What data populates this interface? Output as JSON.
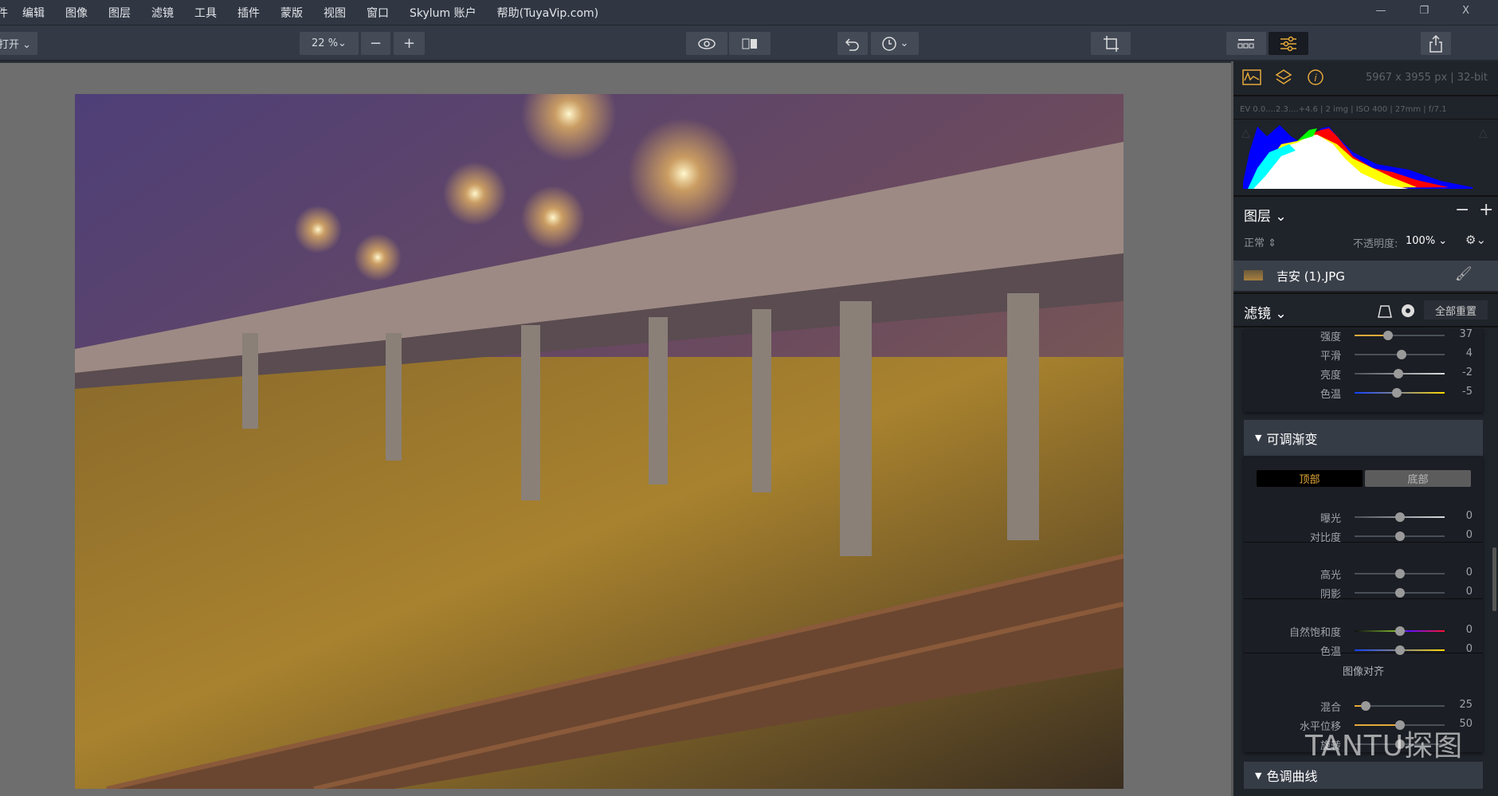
{
  "menu": [
    "编辑",
    "图像",
    "图层",
    "滤镜",
    "工具",
    "插件",
    "蒙版",
    "视图",
    "窗口",
    "Skylum 账户",
    "帮助(TuyaVip.com)"
  ],
  "menu_partial": "件",
  "window_controls": [
    "—",
    "❐",
    "X"
  ],
  "toolbar": {
    "open": "打开 ⌄",
    "zoom": "22 %⌄",
    "zoom_out": "−",
    "zoom_in": "+",
    "history_arrow": "⌄"
  },
  "info": {
    "dimensions": "5967 x 3955 px  |  32-bit",
    "exif": "EV 0.0....2.3....+4.6  |  2 img  |  ISO 400  |  27mm  |  f/7.1"
  },
  "layers": {
    "title": "图层",
    "minus": "−",
    "plus": "+",
    "blend": "正常",
    "opacity_label": "不透明度:",
    "opacity": "100%",
    "layer_name": "吉安 (1).JPG"
  },
  "filters": {
    "title": "滤镜",
    "reset_all": "全部重置"
  },
  "top_sliders": [
    {
      "label": "强度",
      "value": 37,
      "pos": 0.37,
      "type": "amber"
    },
    {
      "label": "平滑",
      "value": 4,
      "pos": 0.52,
      "type": "plain"
    },
    {
      "label": "亮度",
      "value": -2,
      "pos": 0.49,
      "type": "white"
    },
    {
      "label": "色温",
      "value": -5,
      "pos": 0.47,
      "type": "temp"
    }
  ],
  "gradient": {
    "title": "可调渐变",
    "tab_top": "顶部",
    "tab_bottom": "底部",
    "active_tab": "顶部",
    "group1": [
      {
        "label": "曝光",
        "value": 0,
        "pos": 0.5,
        "type": "white"
      },
      {
        "label": "对比度",
        "value": 0,
        "pos": 0.5,
        "type": "plain"
      }
    ],
    "group2": [
      {
        "label": "高光",
        "value": 0,
        "pos": 0.5,
        "type": "plain"
      },
      {
        "label": "阴影",
        "value": 0,
        "pos": 0.5,
        "type": "plain"
      }
    ],
    "group3": [
      {
        "label": "自然饱和度",
        "value": 0,
        "pos": 0.5,
        "type": "vib"
      },
      {
        "label": "色温",
        "value": 0,
        "pos": 0.5,
        "type": "temp"
      }
    ],
    "align_title": "图像对齐",
    "group4": [
      {
        "label": "混合",
        "value": 25,
        "pos": 0.12,
        "type": "amber"
      },
      {
        "label": "水平位移",
        "value": 50,
        "pos": 0.5,
        "type": "amber"
      },
      {
        "label": "旋转",
        "value": "",
        "pos": 0.5,
        "type": "plain"
      }
    ]
  },
  "tone_curve": {
    "title": "色调曲线"
  },
  "watermark": "TANTU探图",
  "colors": {
    "accent": "#e6a93a",
    "panel": "#1f232a",
    "toolbar": "#333a46"
  }
}
